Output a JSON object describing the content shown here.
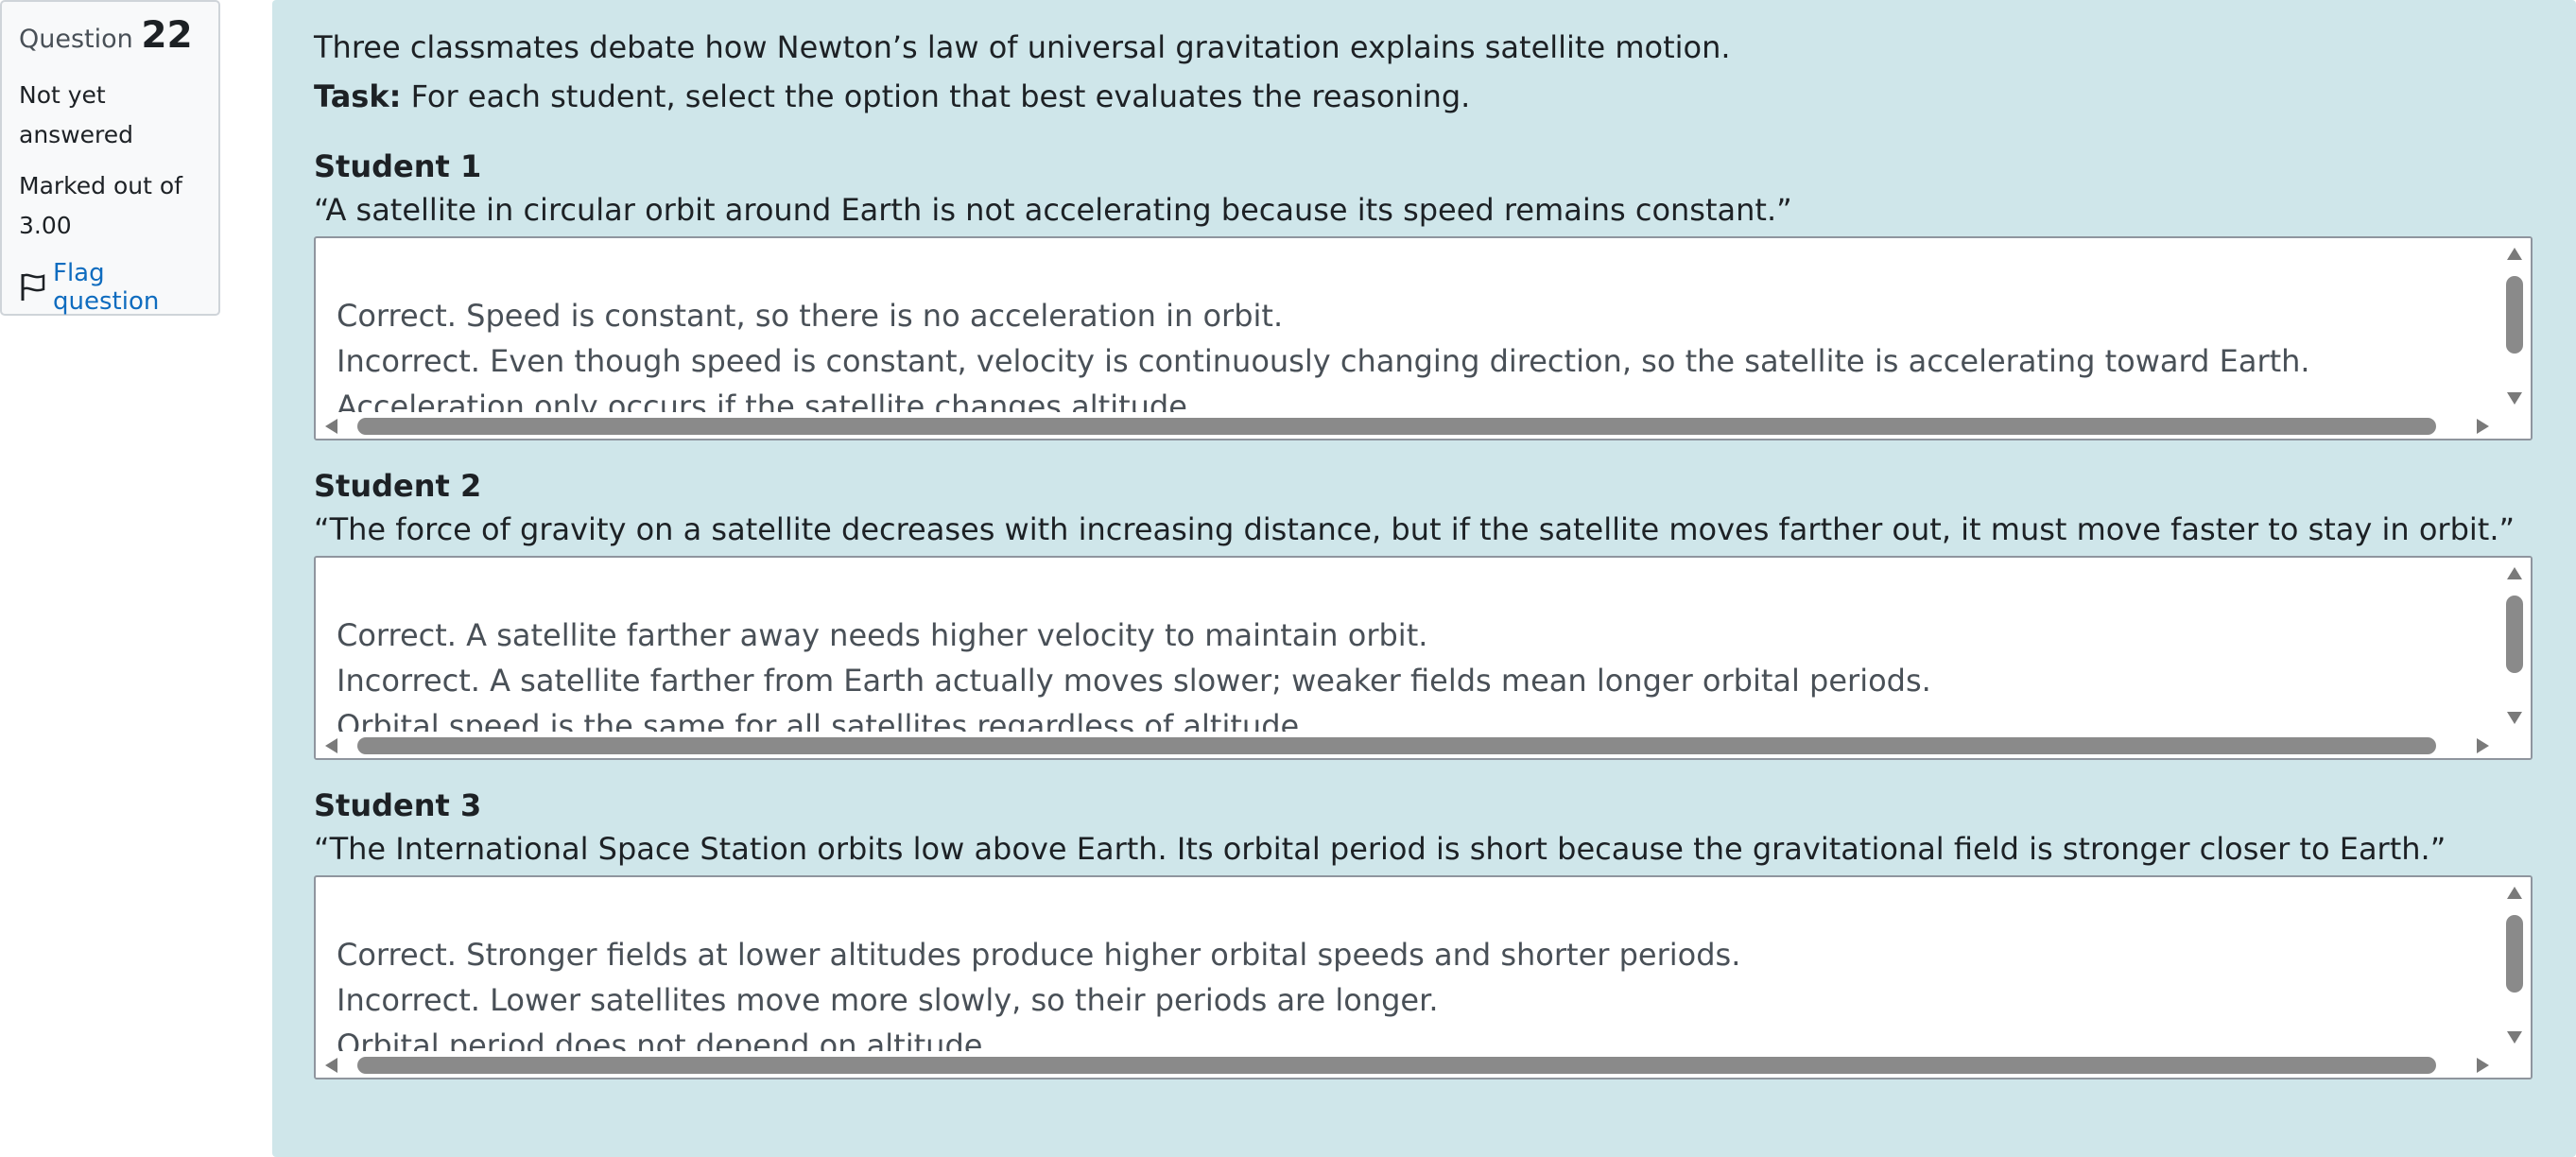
{
  "info": {
    "question_word": "Question",
    "question_number": "22",
    "state": "Not yet answered",
    "grade": "Marked out of 3.00",
    "flag_label": "Flag question"
  },
  "question": {
    "intro": "Three classmates debate how Newton’s law of universal gravitation explains satellite motion.",
    "task_label": "Task:",
    "task_text": " For each student, select the option that best evaluates the reasoning."
  },
  "students": [
    {
      "title": "Student 1",
      "quote": "“A satellite in circular orbit around Earth is not accelerating because its speed remains constant.”",
      "options": [
        "Correct. Speed is constant, so there is no acceleration in orbit.",
        "Incorrect. Even though speed is constant, velocity is continuously changing direction, so the satellite is accelerating toward Earth.",
        "Acceleration only occurs if the satellite changes altitude."
      ]
    },
    {
      "title": "Student 2",
      "quote": "“The force of gravity on a satellite decreases with increasing distance, but if the satellite moves farther out, it must move faster to stay in orbit.”",
      "options": [
        "Correct. A satellite farther away needs higher velocity to maintain orbit.",
        "Incorrect. A satellite farther from Earth actually moves slower; weaker fields mean longer orbital periods.",
        "Orbital speed is the same for all satellites regardless of altitude."
      ]
    },
    {
      "title": "Student 3",
      "quote": "“The International Space Station orbits low above Earth. Its orbital period is short because the gravitational field is stronger closer to Earth.”",
      "options": [
        "Correct. Stronger fields at lower altitudes produce higher orbital speeds and shorter periods.",
        "Incorrect. Lower satellites move more slowly, so their periods are longer.",
        "Orbital period does not depend on altitude."
      ]
    }
  ],
  "colors": {
    "panel_background": "#cfe6ea",
    "info_background": "#f8f9fa",
    "link": "#0f6cbf"
  }
}
